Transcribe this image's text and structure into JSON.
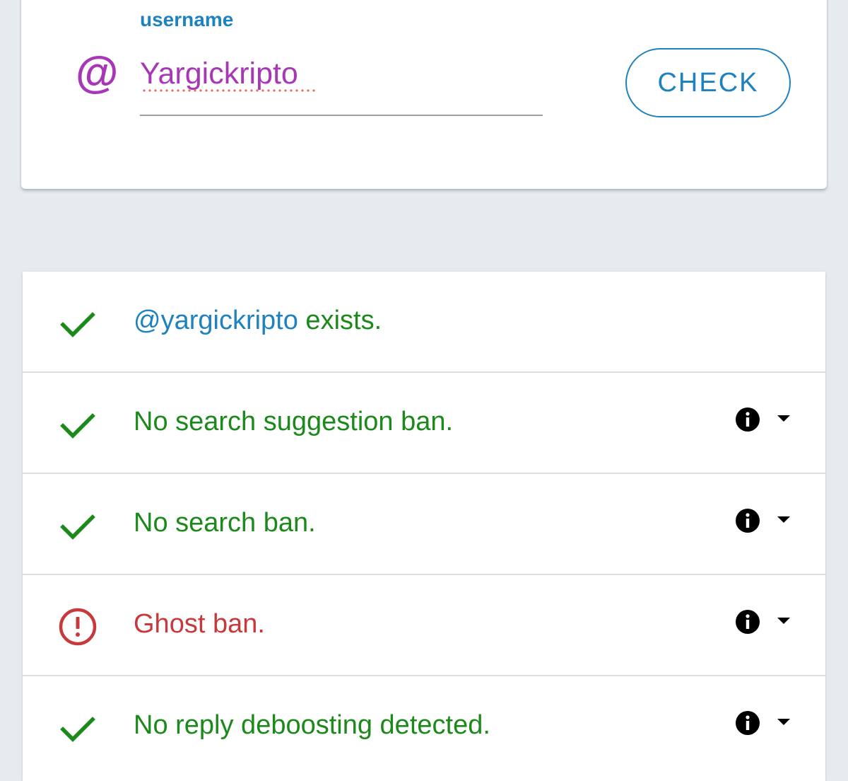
{
  "search": {
    "field_label": "username",
    "at_symbol": "@",
    "username_value": "Yargickripto",
    "check_label": "CHECK"
  },
  "results": [
    {
      "status": "ok",
      "icon": "checkmark-icon",
      "handle": "@yargickripto",
      "text": " exists.",
      "has_details": false
    },
    {
      "status": "ok",
      "icon": "checkmark-icon",
      "text": "No search suggestion ban.",
      "has_details": true
    },
    {
      "status": "ok",
      "icon": "checkmark-icon",
      "text": "No search ban.",
      "has_details": true
    },
    {
      "status": "bad",
      "icon": "alert-circle-icon",
      "text": "Ghost ban.",
      "has_details": true
    },
    {
      "status": "ok",
      "icon": "checkmark-icon",
      "text": "No reply deboosting detected.",
      "has_details": true
    }
  ],
  "colors": {
    "accent_blue": "#1f82c0",
    "input_purple": "#a737b6",
    "ok_green": "#1b8a1b",
    "ban_red": "#c8393c",
    "page_background": "#e6ebf0"
  }
}
